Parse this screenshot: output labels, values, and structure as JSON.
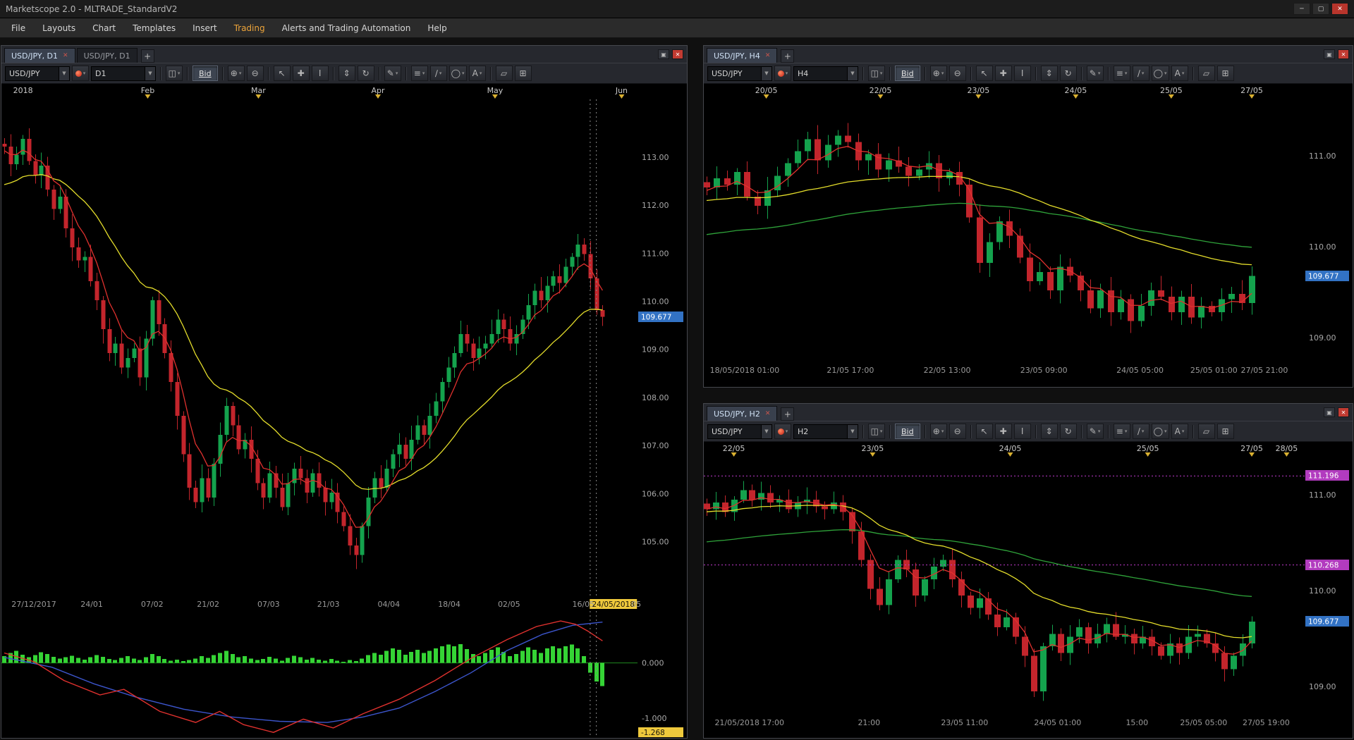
{
  "window": {
    "title": "Marketscope 2.0 - MLTRADE_StandardV2",
    "controls": {
      "minimize": "─",
      "maximize": "▢",
      "close": "✕"
    }
  },
  "menu": {
    "items": [
      {
        "label": "File"
      },
      {
        "label": "Layouts"
      },
      {
        "label": "Chart"
      },
      {
        "label": "Templates"
      },
      {
        "label": "Insert"
      },
      {
        "label": "Trading",
        "accent": true
      },
      {
        "label": "Alerts and Trading Automation"
      },
      {
        "label": "Help"
      }
    ]
  },
  "ui": {
    "add_tab": "+",
    "caret": "▼",
    "caret_small": "▾",
    "tab_close": "✕",
    "mini_restore": "▣",
    "mini_close": "✕"
  },
  "colors": {
    "up": "#14a24d",
    "down": "#c3252c",
    "ma_fast_red": "#e0312e",
    "ma_yellow": "#e4dd2b",
    "ma_green": "#2fa33a",
    "macd_line": "#e0312e",
    "macd_signal": "#3c55cc",
    "macd_hist": "#35d435",
    "macd_zero": "#1f8a1f",
    "badge_blue": "#3272c4",
    "badge_magenta": "#b23bbf",
    "badge_yellow": "#efc93c",
    "marker_yellow": "#d9b031",
    "level_magenta": "#c13bd0",
    "axis_text": "#a8a8a8",
    "axis_top_text": "#c8c8c8",
    "axis_bottom_text": "#9a9a9a"
  },
  "toolbar_icons": [
    {
      "name": "chart-style-button",
      "glyph": "◫",
      "caret": true,
      "sep_before": true
    },
    {
      "name": "bid-button",
      "glyph": "Bid",
      "text": true,
      "active": true,
      "sep_before": true
    },
    {
      "name": "zoom-in-button",
      "glyph": "⊕",
      "caret": true,
      "sep_before": true
    },
    {
      "name": "zoom-out-button",
      "glyph": "⊖"
    },
    {
      "name": "cursor-button",
      "glyph": "↖",
      "sep_before": true
    },
    {
      "name": "crosshair-button",
      "glyph": "✚"
    },
    {
      "name": "text-cursor-button",
      "glyph": "I"
    },
    {
      "name": "fit-vertical-button",
      "glyph": "⇕",
      "sep_before": true
    },
    {
      "name": "refresh-button",
      "glyph": "↻"
    },
    {
      "name": "draw-pencil-button",
      "glyph": "✎",
      "caret": true,
      "sep_before": true
    },
    {
      "name": "indicators-button",
      "glyph": "≡",
      "caret": true,
      "sep_before": true
    },
    {
      "name": "trendline-button",
      "glyph": "∕",
      "caret": true
    },
    {
      "name": "shapes-button",
      "glyph": "◯",
      "caret": true
    },
    {
      "name": "annotations-button",
      "glyph": "A",
      "caret": true
    },
    {
      "name": "eraser-button",
      "glyph": "▱",
      "sep_before": true
    },
    {
      "name": "grid-button",
      "glyph": "⊞"
    }
  ],
  "panels": {
    "d1": {
      "tabs": [
        {
          "label": "USD/JPY, D1",
          "active": true
        },
        {
          "label": "USD/JPY, D1",
          "active": false
        }
      ],
      "toolbar": {
        "symbol": "USD/JPY",
        "period": "D1",
        "bid": "Bid"
      },
      "chart_data": {
        "type": "candlestick",
        "symbol": "USD/JPY",
        "timeframe": "D1",
        "ylim": [
          103.85,
          114.2
        ],
        "y_ticks": [
          {
            "v": 113,
            "label": "113.00"
          },
          {
            "v": 112,
            "label": "112.00"
          },
          {
            "v": 111,
            "label": "111.00"
          },
          {
            "v": 110,
            "label": "110.00"
          },
          {
            "v": 109,
            "label": "109.00"
          },
          {
            "v": 108,
            "label": "108.00"
          },
          {
            "v": 107,
            "label": "107.00"
          },
          {
            "v": 106,
            "label": "106.00"
          },
          {
            "v": 105,
            "label": "105.00"
          }
        ],
        "last_price": 109.677,
        "last_price_label": "109.677",
        "top_axis": [
          {
            "label": "2018",
            "frac": 0.034,
            "marker": false
          },
          {
            "label": "Feb",
            "frac": 0.23
          },
          {
            "label": "Mar",
            "frac": 0.404
          },
          {
            "label": "Apr",
            "frac": 0.592
          },
          {
            "label": "May",
            "frac": 0.776
          },
          {
            "label": "Jun",
            "frac": 0.975
          }
        ],
        "bottom_axis": [
          {
            "label": "27/12/2017",
            "frac": 0.051
          },
          {
            "label": "24/01",
            "frac": 0.142
          },
          {
            "label": "07/02",
            "frac": 0.237
          },
          {
            "label": "21/02",
            "frac": 0.325
          },
          {
            "label": "07/03",
            "frac": 0.42
          },
          {
            "label": "21/03",
            "frac": 0.514
          },
          {
            "label": "04/04",
            "frac": 0.609
          },
          {
            "label": "18/04",
            "frac": 0.704
          },
          {
            "label": "02/05",
            "frac": 0.798
          },
          {
            "label": "16/05",
            "frac": 0.915
          },
          {
            "label": "24/05/2018",
            "frac": 0.962,
            "highlight": true
          },
          {
            "label": "05",
            "frac": 0.998
          }
        ],
        "closes": [
          113.22,
          112.85,
          113.05,
          113.38,
          112.92,
          112.62,
          112.82,
          112.32,
          111.92,
          112.18,
          111.52,
          111.12,
          110.85,
          110.92,
          110.42,
          110.02,
          109.42,
          108.92,
          109.12,
          108.62,
          108.82,
          109.02,
          108.42,
          109.22,
          110.02,
          109.52,
          108.92,
          108.32,
          107.62,
          106.82,
          106.12,
          105.82,
          106.32,
          105.92,
          106.62,
          107.22,
          107.82,
          107.42,
          106.92,
          107.12,
          106.72,
          106.22,
          105.92,
          106.42,
          106.12,
          105.72,
          106.22,
          106.52,
          106.32,
          106.02,
          106.42,
          106.12,
          105.82,
          106.02,
          105.62,
          105.32,
          104.92,
          104.72,
          105.32,
          105.92,
          106.32,
          106.12,
          106.52,
          106.82,
          107.02,
          106.72,
          107.12,
          107.42,
          107.22,
          107.62,
          107.92,
          108.32,
          108.62,
          108.92,
          109.32,
          109.12,
          108.82,
          109.02,
          109.12,
          109.32,
          109.62,
          109.42,
          109.12,
          109.32,
          109.62,
          109.92,
          110.22,
          110.02,
          110.32,
          110.52,
          110.38,
          110.72,
          110.92,
          111.18,
          110.98,
          110.48,
          109.82,
          109.677
        ],
        "mas": [
          {
            "period": 22,
            "color": "ma_yellow",
            "seed": 112.35
          },
          {
            "period": 6,
            "color": "ma_fast_red",
            "seed": 113.1
          }
        ],
        "crosshair_indices": [
          95,
          96
        ],
        "indicator": {
          "name": "MACD",
          "ylim": [
            -1.36,
            0.94
          ],
          "ticks": [
            {
              "v": 0,
              "label": "0.000"
            },
            {
              "v": -1,
              "label": "-1.000"
            }
          ],
          "badge": "-1.268",
          "badge_value": -1.268,
          "hist": [
            0.12,
            0.18,
            0.22,
            0.15,
            0.1,
            0.14,
            0.19,
            0.16,
            0.11,
            0.08,
            0.1,
            0.13,
            0.09,
            0.06,
            0.1,
            0.14,
            0.11,
            0.07,
            0.05,
            0.09,
            0.12,
            0.08,
            0.05,
            0.1,
            0.16,
            0.12,
            0.07,
            0.04,
            0.06,
            0.03,
            0.05,
            0.08,
            0.12,
            0.09,
            0.14,
            0.18,
            0.22,
            0.16,
            0.1,
            0.12,
            0.08,
            0.05,
            0.07,
            0.11,
            0.08,
            0.04,
            0.09,
            0.13,
            0.1,
            0.06,
            0.09,
            0.06,
            0.04,
            0.07,
            0.04,
            0.02,
            0.05,
            0.03,
            0.08,
            0.14,
            0.18,
            0.15,
            0.22,
            0.26,
            0.24,
            0.15,
            0.2,
            0.24,
            0.18,
            0.22,
            0.26,
            0.3,
            0.33,
            0.3,
            0.34,
            0.25,
            0.16,
            0.12,
            0.18,
            0.24,
            0.28,
            0.2,
            0.12,
            0.16,
            0.22,
            0.28,
            0.24,
            0.18,
            0.26,
            0.3,
            0.26,
            0.3,
            0.33,
            0.26,
            0.12,
            -0.18,
            -0.34,
            -0.42
          ],
          "macd_points": [
            [
              0,
              0.18
            ],
            [
              0.05,
              0.02
            ],
            [
              0.1,
              -0.32
            ],
            [
              0.16,
              -0.58
            ],
            [
              0.2,
              -0.48
            ],
            [
              0.26,
              -0.88
            ],
            [
              0.32,
              -1.08
            ],
            [
              0.36,
              -0.88
            ],
            [
              0.4,
              -1.12
            ],
            [
              0.45,
              -1.26
            ],
            [
              0.5,
              -1.02
            ],
            [
              0.55,
              -1.18
            ],
            [
              0.6,
              -0.92
            ],
            [
              0.66,
              -0.66
            ],
            [
              0.72,
              -0.32
            ],
            [
              0.78,
              0.08
            ],
            [
              0.84,
              0.42
            ],
            [
              0.89,
              0.66
            ],
            [
              0.93,
              0.76
            ],
            [
              0.955,
              0.7
            ],
            [
              0.975,
              0.58
            ],
            [
              1,
              0.4
            ]
          ],
          "signal_points": [
            [
              0,
              0.1
            ],
            [
              0.08,
              -0.08
            ],
            [
              0.15,
              -0.38
            ],
            [
              0.22,
              -0.62
            ],
            [
              0.3,
              -0.84
            ],
            [
              0.38,
              -0.98
            ],
            [
              0.46,
              -1.06
            ],
            [
              0.54,
              -1.08
            ],
            [
              0.6,
              -0.98
            ],
            [
              0.66,
              -0.82
            ],
            [
              0.72,
              -0.52
            ],
            [
              0.78,
              -0.18
            ],
            [
              0.84,
              0.22
            ],
            [
              0.9,
              0.52
            ],
            [
              0.95,
              0.68
            ],
            [
              1,
              0.74
            ]
          ]
        }
      }
    },
    "h4": {
      "tabs": [
        {
          "label": "USD/JPY, H4",
          "active": true
        }
      ],
      "toolbar": {
        "symbol": "USD/JPY",
        "period": "H4",
        "bid": "Bid"
      },
      "chart_data": {
        "type": "candlestick",
        "symbol": "USD/JPY",
        "timeframe": "H4",
        "ylim": [
          108.72,
          111.62
        ],
        "y_ticks": [
          {
            "v": 111,
            "label": "111.00"
          },
          {
            "v": 110,
            "label": "110.00"
          },
          {
            "v": 109,
            "label": "109.00"
          }
        ],
        "last_price": 109.677,
        "last_price_label": "109.677",
        "top_axis": [
          {
            "label": "20/05",
            "frac": 0.104
          },
          {
            "label": "22/05",
            "frac": 0.294
          },
          {
            "label": "23/05",
            "frac": 0.457
          },
          {
            "label": "24/05",
            "frac": 0.619
          },
          {
            "label": "25/05",
            "frac": 0.778
          },
          {
            "label": "27/05",
            "frac": 0.912
          }
        ],
        "bottom_axis": [
          {
            "label": "18/05/2018 01:00",
            "frac": 0.068
          },
          {
            "label": "21/05 17:00",
            "frac": 0.244
          },
          {
            "label": "22/05 13:00",
            "frac": 0.405
          },
          {
            "label": "23/05 09:00",
            "frac": 0.566
          },
          {
            "label": "24/05 05:00",
            "frac": 0.726
          },
          {
            "label": "25/05 01:00",
            "frac": 0.849
          },
          {
            "label": "27/05 21:00",
            "frac": 0.933
          }
        ],
        "closes": [
          110.65,
          110.75,
          110.68,
          110.82,
          110.55,
          110.45,
          110.62,
          110.78,
          110.92,
          111.05,
          111.18,
          110.95,
          111.12,
          111.22,
          111.15,
          110.95,
          111.02,
          110.85,
          110.95,
          110.88,
          110.78,
          110.85,
          110.92,
          110.75,
          110.82,
          110.68,
          110.32,
          109.82,
          110.05,
          110.28,
          110.12,
          109.88,
          109.62,
          109.72,
          109.52,
          109.78,
          109.68,
          109.52,
          109.32,
          109.52,
          109.28,
          109.42,
          109.18,
          109.35,
          109.52,
          109.45,
          109.28,
          109.45,
          109.22,
          109.35,
          109.28,
          109.42,
          109.48,
          109.38,
          109.677
        ],
        "mas": [
          {
            "period": 80,
            "color": "ma_green",
            "seed": 110.12
          },
          {
            "period": 40,
            "color": "ma_yellow",
            "seed": 110.5
          },
          {
            "period": 5,
            "color": "ma_fast_red",
            "seed": 110.6
          }
        ]
      }
    },
    "h2": {
      "tabs": [
        {
          "label": "USD/JPY, H2",
          "active": true
        }
      ],
      "toolbar": {
        "symbol": "USD/JPY",
        "period": "H2",
        "bid": "Bid"
      },
      "chart_data": {
        "type": "candlestick",
        "symbol": "USD/JPY",
        "timeframe": "H2",
        "ylim": [
          108.7,
          111.39
        ],
        "y_ticks": [
          {
            "v": 111,
            "label": "111.00"
          },
          {
            "v": 110,
            "label": "110.00"
          },
          {
            "v": 109,
            "label": "109.00"
          }
        ],
        "last_price": 109.677,
        "last_price_label": "109.677",
        "levels": [
          {
            "price": 111.196,
            "label": "111.196"
          },
          {
            "price": 110.268,
            "label": "110.268"
          }
        ],
        "top_axis": [
          {
            "label": "22/05",
            "frac": 0.05
          },
          {
            "label": "23/05",
            "frac": 0.281
          },
          {
            "label": "24/05",
            "frac": 0.51
          },
          {
            "label": "25/05",
            "frac": 0.739
          },
          {
            "label": "27/05",
            "frac": 0.912
          },
          {
            "label": "28/05",
            "frac": 0.97
          }
        ],
        "bottom_axis": [
          {
            "label": "21/05/2018 17:00",
            "frac": 0.076
          },
          {
            "label": "21:00",
            "frac": 0.275
          },
          {
            "label": "23/05 11:00",
            "frac": 0.434
          },
          {
            "label": "24/05 01:00",
            "frac": 0.589
          },
          {
            "label": "15:00",
            "frac": 0.721
          },
          {
            "label": "25/05 05:00",
            "frac": 0.832
          },
          {
            "label": "27/05 19:00",
            "frac": 0.936
          }
        ],
        "closes": [
          110.85,
          110.92,
          110.82,
          110.95,
          111.05,
          110.95,
          111.02,
          110.92,
          110.95,
          110.85,
          110.92,
          110.95,
          110.88,
          110.85,
          110.92,
          110.82,
          110.62,
          110.32,
          110.02,
          109.85,
          110.12,
          110.32,
          110.22,
          109.95,
          110.12,
          110.25,
          110.32,
          110.12,
          109.95,
          109.82,
          109.92,
          109.75,
          109.62,
          109.72,
          109.52,
          109.32,
          108.95,
          109.42,
          109.55,
          109.35,
          109.52,
          109.62,
          109.45,
          109.55,
          109.65,
          109.52,
          109.55,
          109.45,
          109.52,
          109.42,
          109.32,
          109.45,
          109.35,
          109.52,
          109.55,
          109.45,
          109.35,
          109.18,
          109.32,
          109.45,
          109.677
        ],
        "mas": [
          {
            "period": 80,
            "color": "ma_green",
            "seed": 110.5
          },
          {
            "period": 24,
            "color": "ma_yellow",
            "seed": 110.82
          },
          {
            "period": 5,
            "color": "ma_fast_red",
            "seed": 110.85
          }
        ]
      }
    }
  }
}
